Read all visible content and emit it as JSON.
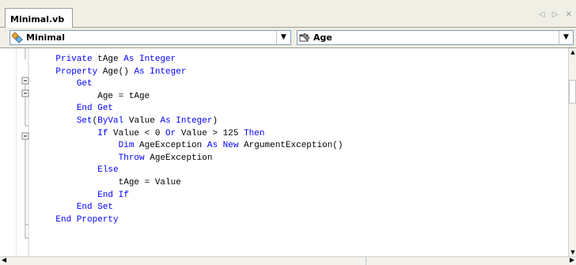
{
  "tab": {
    "title": "Minimal.vb",
    "controls": "◁ ▷ ✕"
  },
  "nav": {
    "class_combo": "Minimal",
    "member_combo": "Age"
  },
  "code_lines": [
    [
      {
        "t": "    "
      },
      {
        "t": "Private",
        "k": 1
      },
      {
        "t": " tAge "
      },
      {
        "t": "As",
        "k": 1
      },
      {
        "t": " "
      },
      {
        "t": "Integer",
        "k": 1
      }
    ],
    [
      {
        "t": "    "
      },
      {
        "t": "Property",
        "k": 1
      },
      {
        "t": " Age() "
      },
      {
        "t": "As",
        "k": 1
      },
      {
        "t": " "
      },
      {
        "t": "Integer",
        "k": 1
      }
    ],
    [
      {
        "t": "        "
      },
      {
        "t": "Get",
        "k": 1
      }
    ],
    [
      {
        "t": "            Age = tAge"
      }
    ],
    [
      {
        "t": "        "
      },
      {
        "t": "End Get",
        "k": 1
      }
    ],
    [
      {
        "t": "        "
      },
      {
        "t": "Set",
        "k": 1
      },
      {
        "t": "("
      },
      {
        "t": "ByVal",
        "k": 1
      },
      {
        "t": " Value "
      },
      {
        "t": "As",
        "k": 1
      },
      {
        "t": " "
      },
      {
        "t": "Integer",
        "k": 1
      },
      {
        "t": ")"
      }
    ],
    [
      {
        "t": "            "
      },
      {
        "t": "If",
        "k": 1
      },
      {
        "t": " Value < 0 "
      },
      {
        "t": "Or",
        "k": 1
      },
      {
        "t": " Value > 125 "
      },
      {
        "t": "Then",
        "k": 1
      }
    ],
    [
      {
        "t": "                "
      },
      {
        "t": "Dim",
        "k": 1
      },
      {
        "t": " AgeException "
      },
      {
        "t": "As",
        "k": 1
      },
      {
        "t": " "
      },
      {
        "t": "New",
        "k": 1
      },
      {
        "t": " ArgumentException()"
      }
    ],
    [
      {
        "t": "                "
      },
      {
        "t": "Throw",
        "k": 1
      },
      {
        "t": " AgeException"
      }
    ],
    [
      {
        "t": "            "
      },
      {
        "t": "Else",
        "k": 1
      }
    ],
    [
      {
        "t": "                tAge = Value"
      }
    ],
    [
      {
        "t": "            "
      },
      {
        "t": "End If",
        "k": 1
      }
    ],
    [
      {
        "t": "        "
      },
      {
        "t": "End Set",
        "k": 1
      }
    ],
    [
      {
        "t": "    "
      },
      {
        "t": "End Property",
        "k": 1
      }
    ]
  ],
  "colors": {
    "keyword": "#0000ff",
    "text": "#000000",
    "chrome": "#f0efe6"
  },
  "icons": {
    "class_combo_icon": "class-icon",
    "member_combo_icon": "property-icon"
  }
}
